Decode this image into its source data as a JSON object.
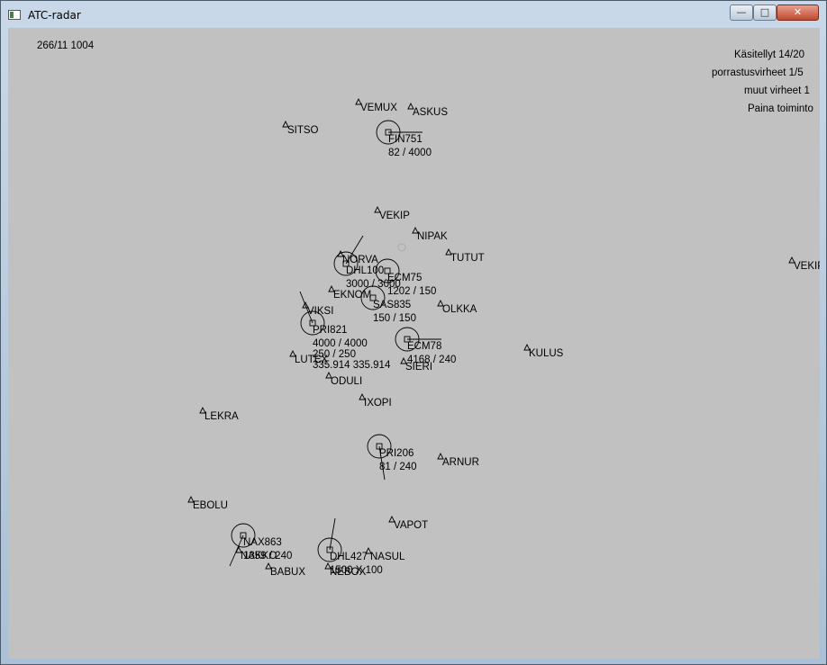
{
  "window": {
    "title": "ATC-radar",
    "min_label": "—",
    "max_label": "□",
    "close_label": "✕"
  },
  "header": {
    "clock": "266/11 1004"
  },
  "status": {
    "handled": "Käsitellyt 14/20",
    "separation_errors": "porrastusvirheet 1/5",
    "other_errors": "muut virheet 1",
    "prompt": "Paina toiminto"
  },
  "waypoints": [
    "VEMUX",
    "ASKUS",
    "SITSO",
    "VEKIP",
    "NIPAK",
    "TUTUT",
    "NORVA",
    "EKNOM",
    "OLKKA",
    "VIKSI",
    "KULUS",
    "LUTEX",
    "SIERI",
    "ODULI",
    "IXOPI",
    "LEKRA",
    "ARNUR",
    "EBOLU",
    "VAPOT",
    "NASUL",
    "NAKKO",
    "BABUX",
    "NEBOX",
    "VEKIP"
  ],
  "aircraft": [
    {
      "callsign": "FIN751",
      "data": "82 /     4000"
    },
    {
      "callsign": "DHL100",
      "data": "3000 / 3000"
    },
    {
      "callsign": "ECM75",
      "data": "1202 /  150"
    },
    {
      "callsign": "SAS835",
      "data": "150 /   150"
    },
    {
      "callsign": "PRI821",
      "data": "4000 /  4000",
      "data2": "250 /    250",
      "data3": "335.914 335.914"
    },
    {
      "callsign": "ECM78",
      "data": "4168 /  240"
    },
    {
      "callsign": "PRI206",
      "data": "81 /      240"
    },
    {
      "callsign": "NAX863",
      "data": "1359 /   240"
    },
    {
      "callsign": "DHL427",
      "data": "1500 X 100"
    }
  ],
  "colors": {
    "radar_bg": "#c2c1c1",
    "symbol": "#000000",
    "beacon": "#aaaaaa"
  }
}
